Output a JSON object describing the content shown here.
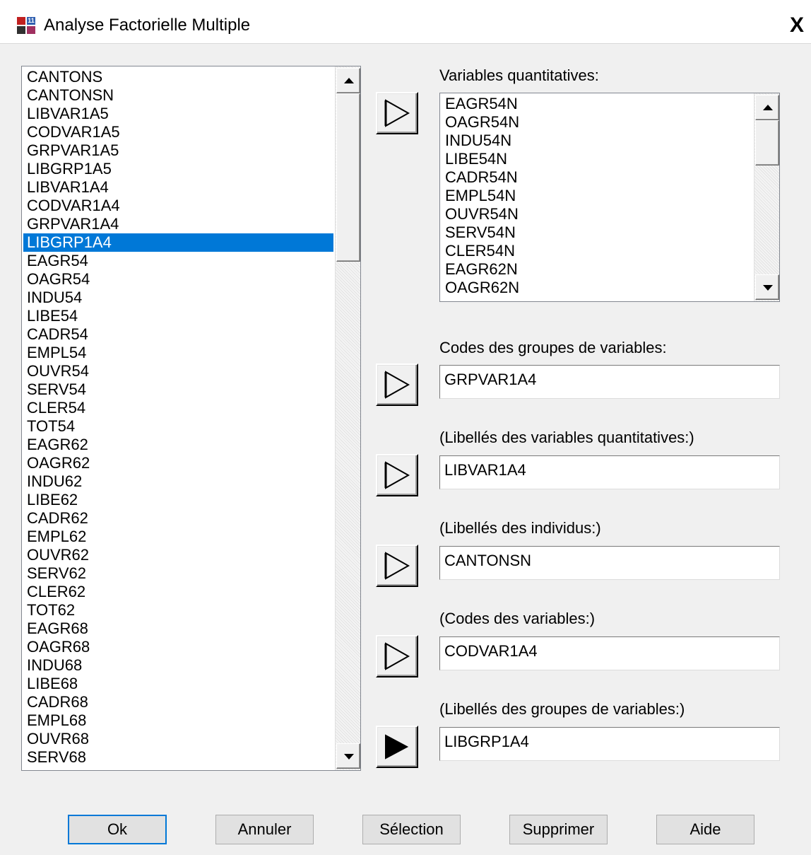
{
  "window": {
    "title": "Analyse Factorielle Multiple",
    "close_label": "X"
  },
  "left_list": {
    "items": [
      "CANTONS",
      "CANTONSN",
      "LIBVAR1A5",
      "CODVAR1A5",
      "GRPVAR1A5",
      "LIBGRP1A5",
      "LIBVAR1A4",
      "CODVAR1A4",
      "GRPVAR1A4",
      "LIBGRP1A4",
      "EAGR54",
      "OAGR54",
      "INDU54",
      "LIBE54",
      "CADR54",
      "EMPL54",
      "OUVR54",
      "SERV54",
      "CLER54",
      "TOT54",
      "EAGR62",
      "OAGR62",
      "INDU62",
      "LIBE62",
      "CADR62",
      "EMPL62",
      "OUVR62",
      "SERV62",
      "CLER62",
      "TOT62",
      "EAGR68",
      "OAGR68",
      "INDU68",
      "LIBE68",
      "CADR68",
      "EMPL68",
      "OUVR68",
      "SERV68"
    ],
    "selected_index": 9
  },
  "quant": {
    "label": "Variables quantitatives:",
    "items": [
      "EAGR54N",
      "OAGR54N",
      "INDU54N",
      "LIBE54N",
      "CADR54N",
      "EMPL54N",
      "OUVR54N",
      "SERV54N",
      "CLER54N",
      "EAGR62N",
      "OAGR62N"
    ]
  },
  "fields": [
    {
      "label": "Codes des groupes de variables:",
      "value": "GRPVAR1A4"
    },
    {
      "label": "(Libellés des variables quantitatives:)",
      "value": "LIBVAR1A4"
    },
    {
      "label": "(Libellés des individus:)",
      "value": "CANTONSN"
    },
    {
      "label": "(Codes des variables:)",
      "value": "CODVAR1A4"
    },
    {
      "label": "(Libellés des groupes de variables:)",
      "value": "LIBGRP1A4"
    }
  ],
  "buttons": {
    "ok": "Ok",
    "cancel": "Annuler",
    "selection": "Sélection",
    "delete": "Supprimer",
    "help": "Aide"
  },
  "colors": {
    "selection": "#0078d7",
    "face": "#f0f0f0"
  },
  "icons": {
    "add_outline": "arrow-right-outline-icon",
    "add_filled": "arrow-right-filled-icon"
  }
}
